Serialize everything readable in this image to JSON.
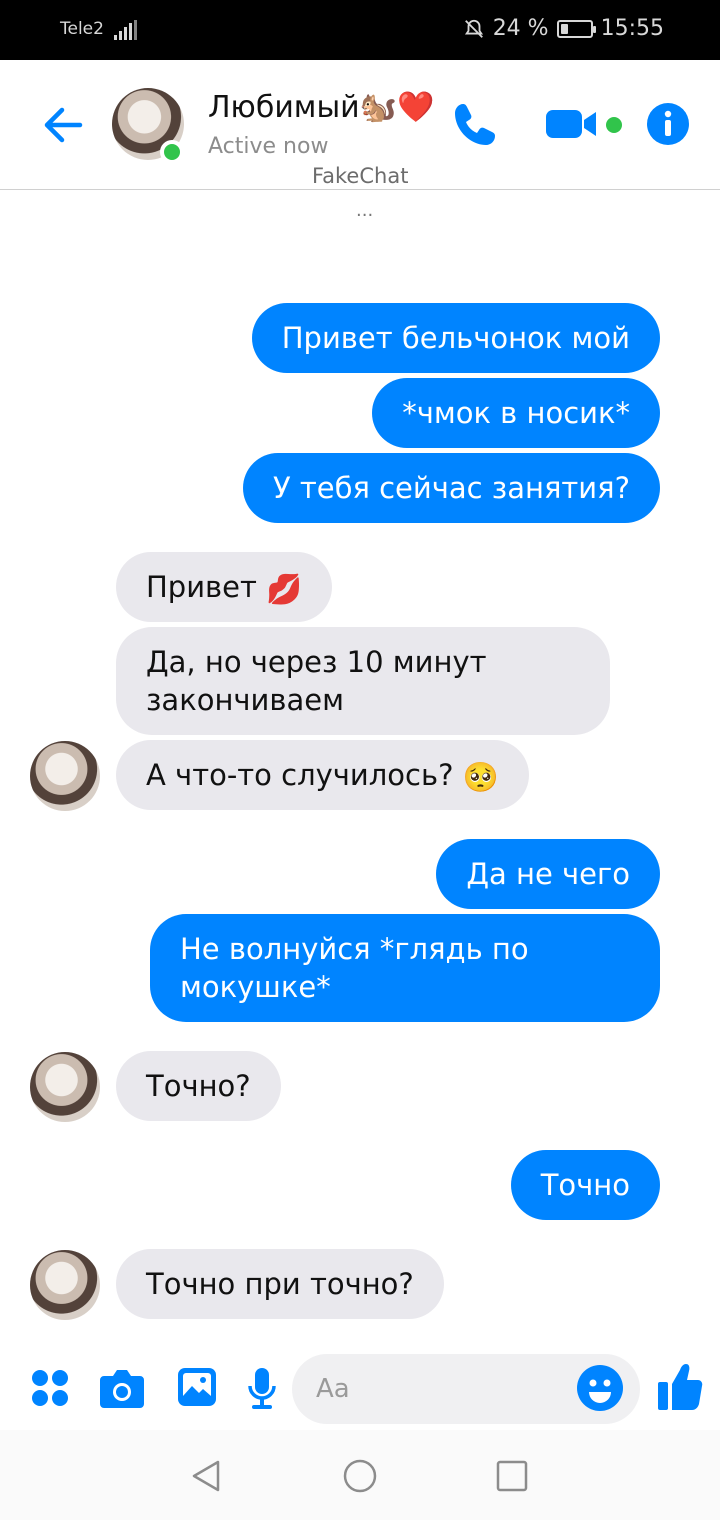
{
  "status_bar": {
    "carrier": "Tele2",
    "battery": "24 %",
    "time": "15:55"
  },
  "header": {
    "contact_name": "Любимый🐿️❤️",
    "status": "Active now",
    "watermark": "FakeChat"
  },
  "typing_indicator": "...",
  "messages": [
    {
      "side": "out",
      "text": "Привет бельчонок мой"
    },
    {
      "side": "out",
      "text": "*чмок в носик*"
    },
    {
      "side": "out",
      "text": "У тебя сейчас занятия?"
    },
    {
      "side": "in",
      "text": "Привет",
      "emoji": "💋"
    },
    {
      "side": "in",
      "line1": "Да, но через 10 минут",
      "line2": "закончиваем"
    },
    {
      "side": "in",
      "text": "А что-то случилось?",
      "emoji": "🥺"
    },
    {
      "side": "out",
      "text": "Да не чего"
    },
    {
      "side": "out",
      "line1": "Не волнуйся *глядь по",
      "line2": "мокушке*"
    },
    {
      "side": "in",
      "text": "Точно?"
    },
    {
      "side": "out",
      "text": "Точно"
    },
    {
      "side": "in",
      "text": "Точно при точно?"
    }
  ],
  "composer": {
    "placeholder": "Aa"
  },
  "colors": {
    "accent": "#0084ff",
    "incoming_bubble": "#e9e8ed",
    "online": "#31c44b"
  }
}
